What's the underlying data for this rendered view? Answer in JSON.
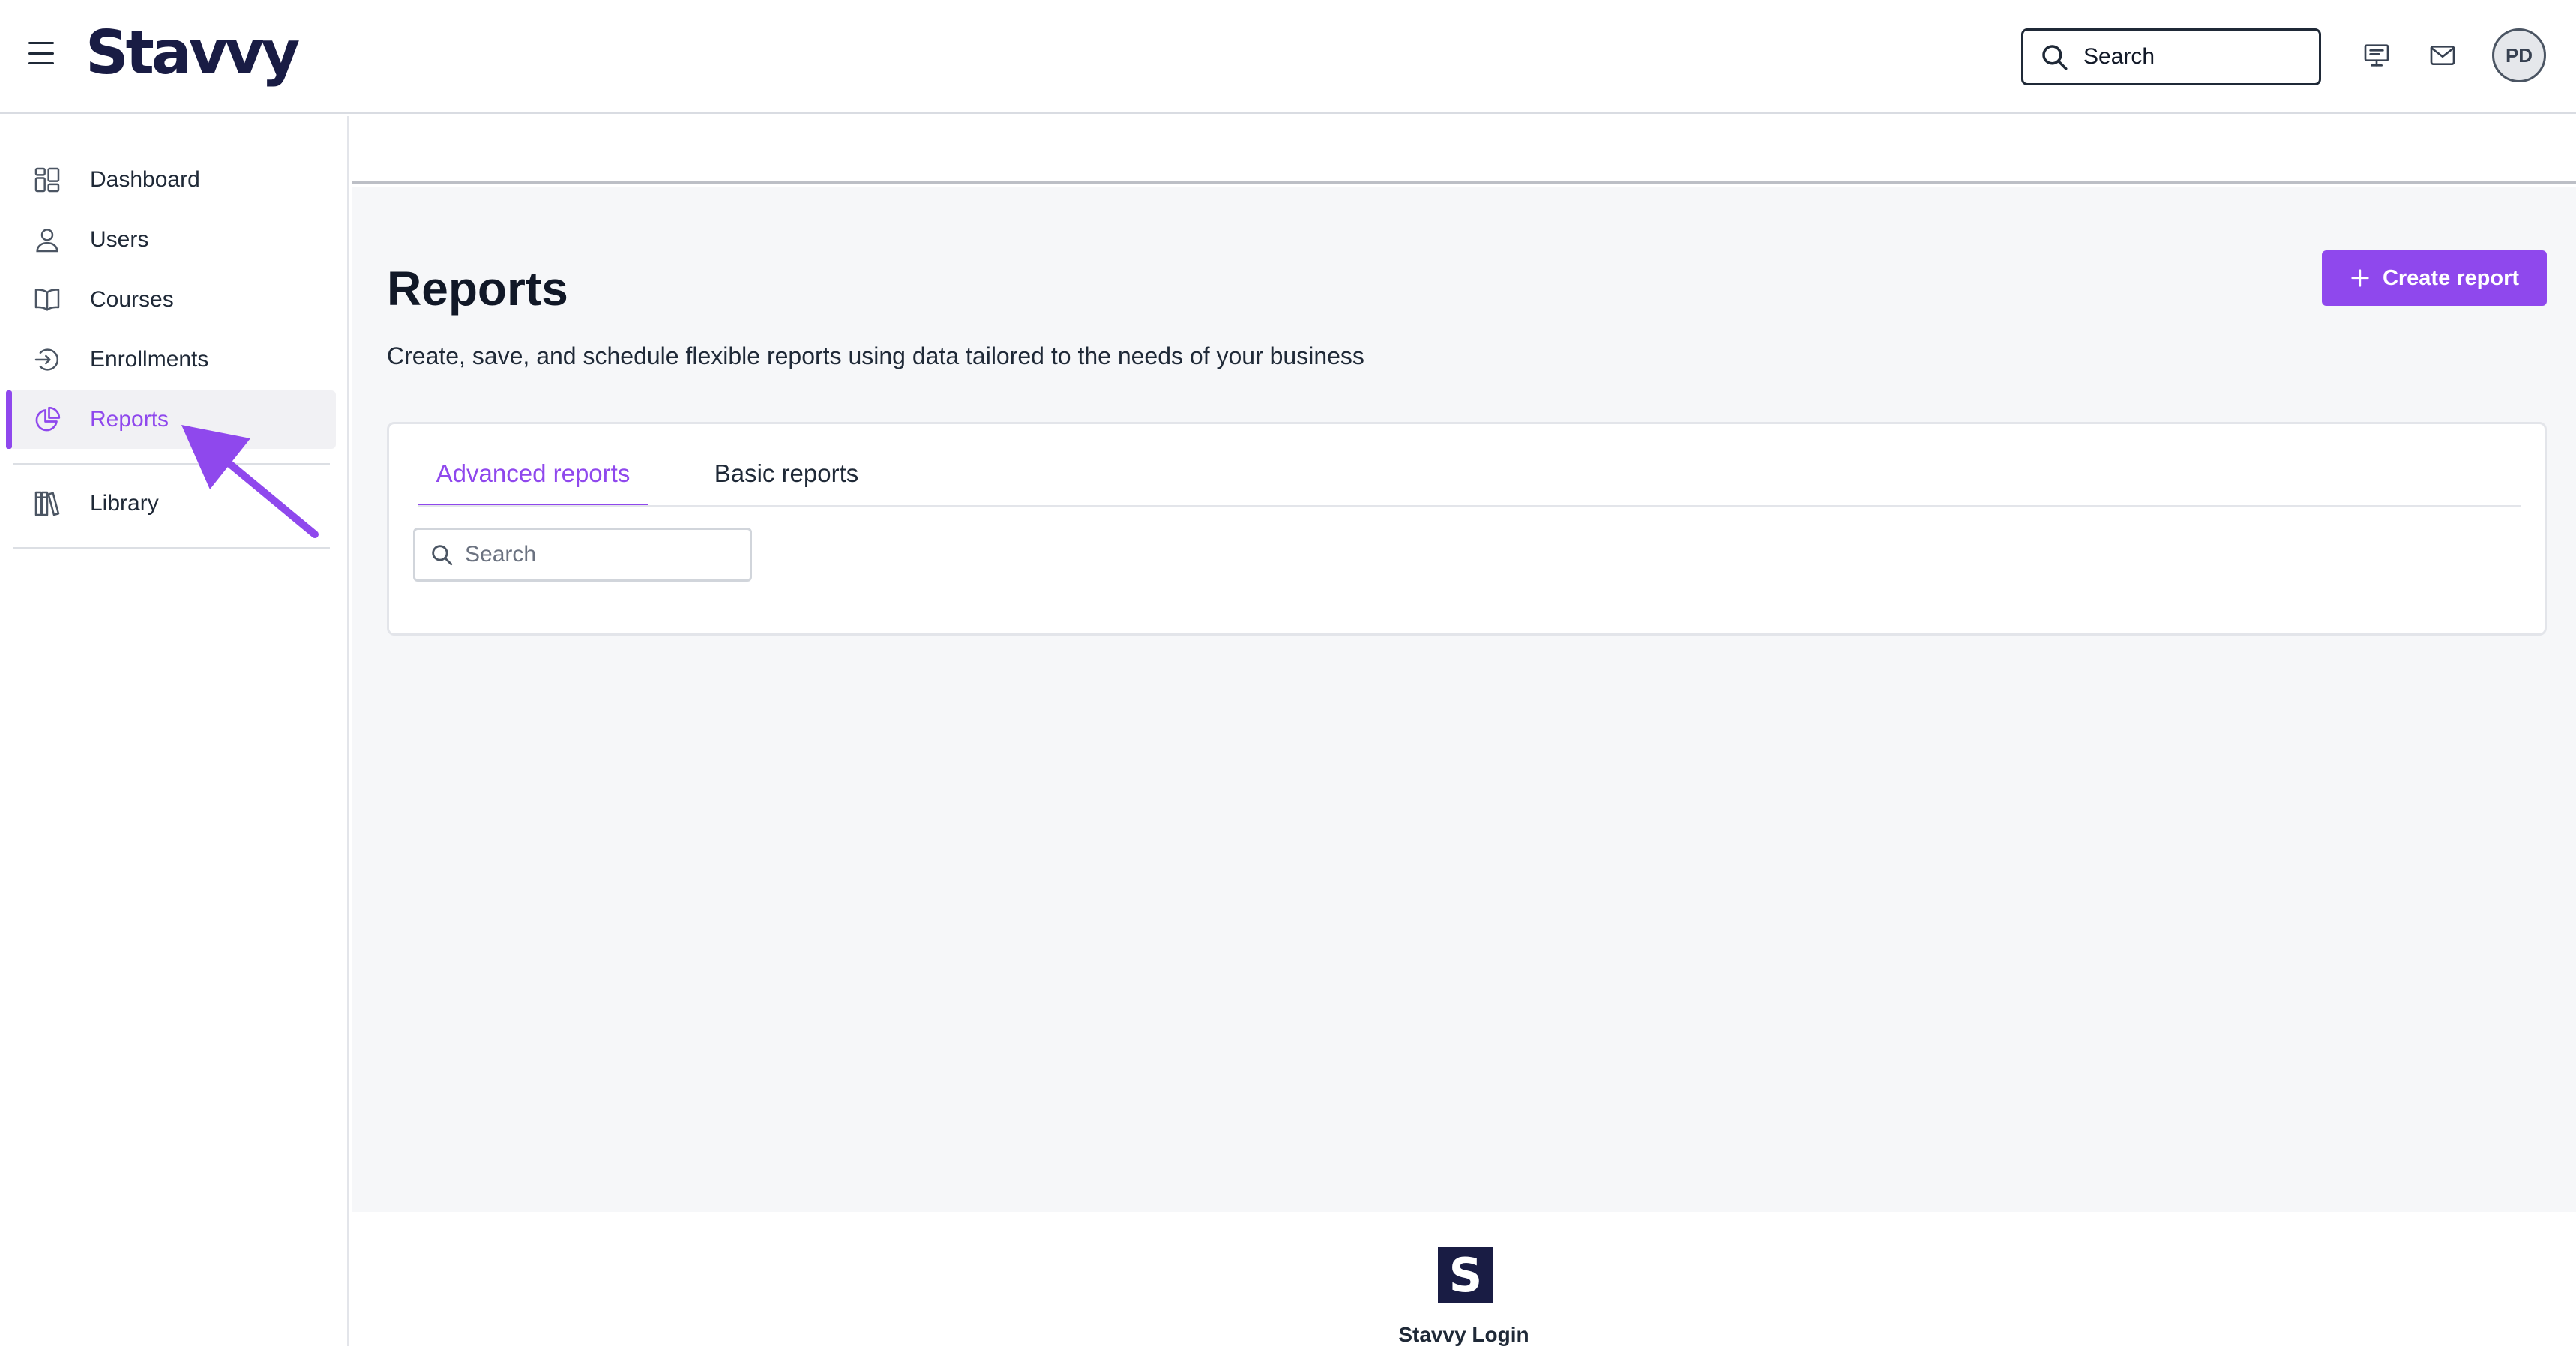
{
  "app": {
    "brand": "Stavvy"
  },
  "header": {
    "search_placeholder": "Search",
    "icons": [
      "menu-icon",
      "presentation-icon",
      "mail-icon"
    ],
    "avatar_initials": "PD"
  },
  "sidebar": {
    "items": [
      {
        "label": "Dashboard",
        "icon": "dashboard-icon",
        "active": false
      },
      {
        "label": "Users",
        "icon": "user-icon",
        "active": false
      },
      {
        "label": "Courses",
        "icon": "book-icon",
        "active": false
      },
      {
        "label": "Enrollments",
        "icon": "enroll-icon",
        "active": false
      },
      {
        "label": "Reports",
        "icon": "pie-chart-icon",
        "active": true
      },
      {
        "label": "Library",
        "icon": "library-icon",
        "active": false
      }
    ]
  },
  "main": {
    "title": "Reports",
    "subtitle": "Create, save, and schedule flexible reports using data tailored to the needs of your business",
    "create_button_label": "Create report",
    "tabs": [
      {
        "label": "Advanced reports",
        "active": true
      },
      {
        "label": "Basic reports",
        "active": false
      }
    ],
    "search_placeholder": "Search"
  },
  "footer": {
    "logo_letter": "S",
    "text": "Stavvy Login"
  },
  "colors": {
    "accent": "#8f48ed",
    "brand_navy": "#191c44",
    "background": "#f6f7f9"
  }
}
